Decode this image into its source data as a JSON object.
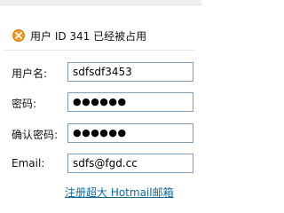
{
  "status": {
    "icon": "error-icon",
    "message": "用户 ID 341 已经被占用"
  },
  "form": {
    "username_label": "用户名:",
    "username_value": "sdfsdf3453",
    "password_label": "密码:",
    "password_value": "●●●●●●",
    "confirm_label": "确认密码:",
    "confirm_value": "●●●●●●",
    "email_label": "Email:",
    "email_value": "sdfs@fgd.cc"
  },
  "link": {
    "register": "注册超大 Hotmail邮箱"
  },
  "colors": {
    "accent": "#f39a1e",
    "link": "#0c6b9a",
    "input_border": "#7f9db9"
  }
}
